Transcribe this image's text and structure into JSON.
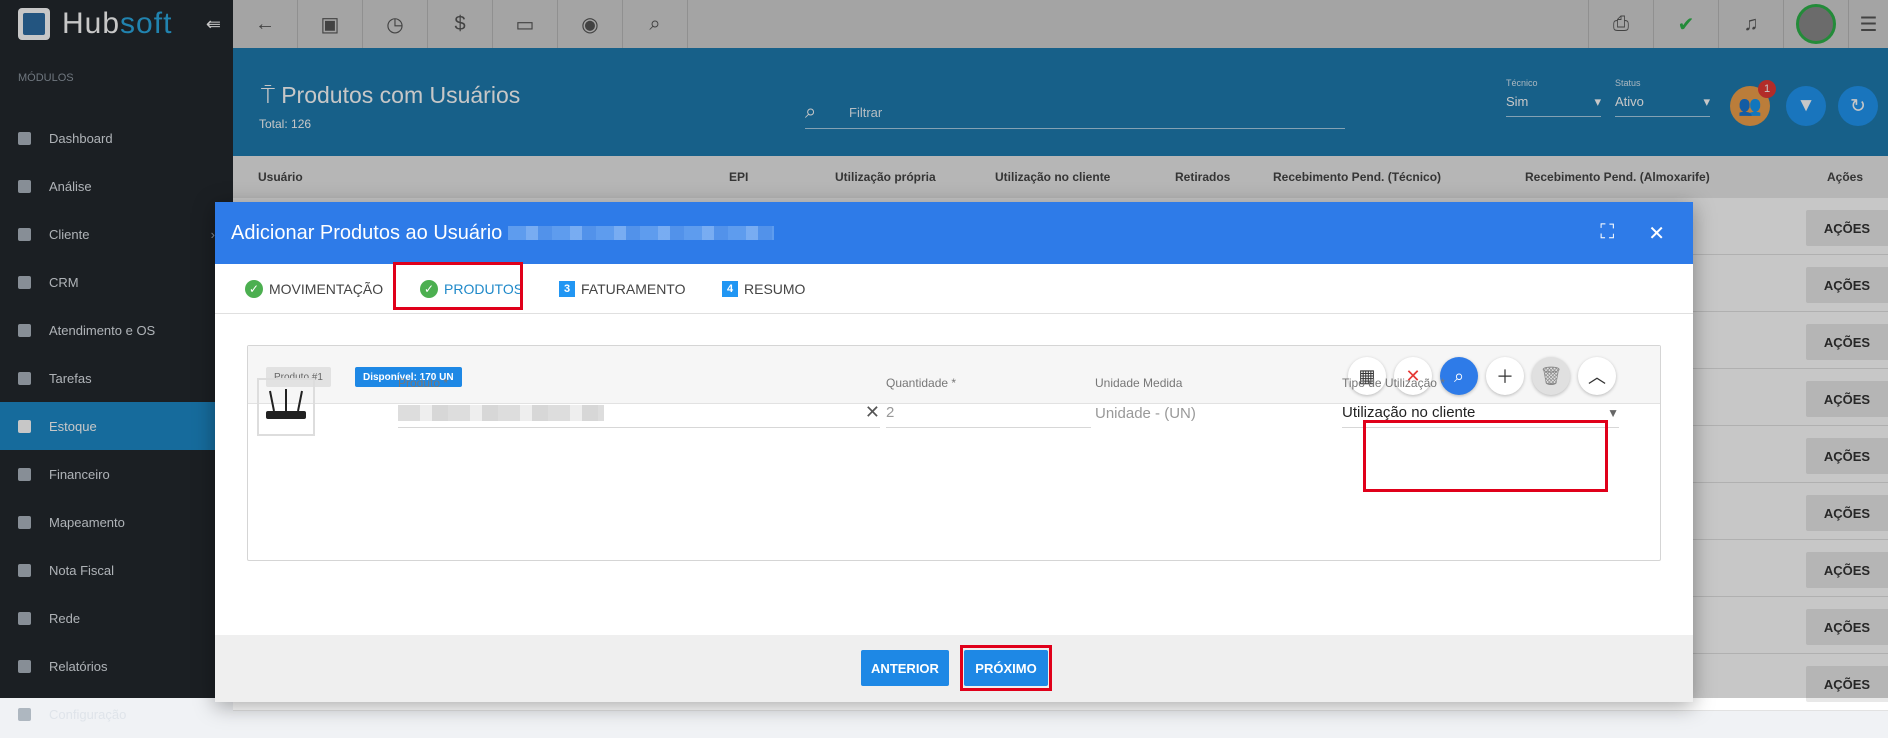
{
  "brand": {
    "name_a": "Hub",
    "name_b": "soft",
    "collapse_icon": "collapse-arrow-icon"
  },
  "sidebar": {
    "section_label": "MÓDULOS",
    "items": [
      {
        "label": "Dashboard",
        "icon": "dashboard-icon"
      },
      {
        "label": "Análise",
        "icon": "pie-chart-icon"
      },
      {
        "label": "Cliente",
        "icon": "contact-card-icon"
      },
      {
        "label": "CRM",
        "icon": "crm-board-icon"
      },
      {
        "label": "Atendimento e OS",
        "icon": "calendar-clock-icon"
      },
      {
        "label": "Tarefas",
        "icon": "briefcase-icon"
      },
      {
        "label": "Estoque",
        "icon": "box-icon"
      },
      {
        "label": "Financeiro",
        "icon": "money-icon"
      },
      {
        "label": "Mapeamento",
        "icon": "map-pin-icon"
      },
      {
        "label": "Nota Fiscal",
        "icon": "document-icon"
      },
      {
        "label": "Rede",
        "icon": "server-icon"
      },
      {
        "label": "Relatórios",
        "icon": "report-icon"
      },
      {
        "label": "Configuração",
        "icon": "gear-icon"
      }
    ]
  },
  "topbar": {
    "left_icons": [
      "back-arrow-icon",
      "contact-icon",
      "calendar-icon",
      "dollar-icon",
      "terminal-icon",
      "eye-icon",
      "search-icon"
    ],
    "right_icons": [
      "pdf-icon",
      "chat-check-icon",
      "bell-icon",
      "user-avatar-icon",
      "list-icon"
    ]
  },
  "header": {
    "title": "Produtos com Usuários",
    "total": "Total: 126",
    "filter_placeholder": "Filtrar",
    "tecnico_label": "Técnico",
    "tecnico_value": "Sim",
    "status_label": "Status",
    "status_value": "Ativo",
    "badge_count": "1"
  },
  "table": {
    "columns": [
      "Usuário",
      "EPI",
      "Utilização própria",
      "Utilização no cliente",
      "Retirados",
      "Recebimento Pend. (Técnico)",
      "Recebimento Pend. (Almoxarife)",
      "Ações"
    ],
    "action_label": "AÇÕES"
  },
  "modal": {
    "title": "Adicionar Produtos ao Usuário",
    "steps": [
      {
        "label": "MOVIMENTAÇÃO",
        "marker": "✓"
      },
      {
        "label": "PRODUTOS",
        "marker": "✓"
      },
      {
        "label": "FATURAMENTO",
        "marker": "3"
      },
      {
        "label": "RESUMO",
        "marker": "4"
      }
    ],
    "product": {
      "chip_label": "Produto #1",
      "available": "Disponível: 170 UN",
      "produto_label": "Produto *",
      "quantidade_label": "Quantidade *",
      "quantidade_value": "2",
      "unidade_label": "Unidade Medida",
      "unidade_value": "Unidade - (UN)",
      "tipo_label": "Tipo de Utilização *",
      "tipo_value": "Utilização no cliente"
    },
    "buttons": {
      "previous": "ANTERIOR",
      "next": "PRÓXIMO"
    }
  }
}
